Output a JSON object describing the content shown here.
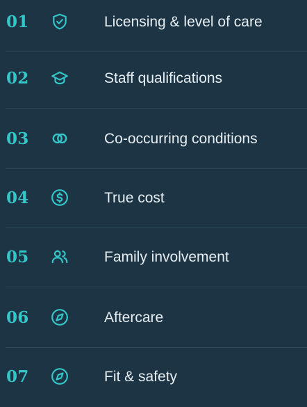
{
  "colors": {
    "background": "#1d3445",
    "accent": "#34c7c9",
    "text": "#e6eef2",
    "divider": "#2d4a5d"
  },
  "items": [
    {
      "number": "01",
      "icon": "shield-check-icon",
      "label": "Licensing & level of care"
    },
    {
      "number": "02",
      "icon": "graduation-cap-icon",
      "label": "Staff qualifications"
    },
    {
      "number": "03",
      "icon": "overlapping-circles-icon",
      "label": "Co-occurring conditions"
    },
    {
      "number": "04",
      "icon": "dollar-circle-icon",
      "label": "True cost"
    },
    {
      "number": "05",
      "icon": "users-icon",
      "label": "Family involvement"
    },
    {
      "number": "06",
      "icon": "compass-icon",
      "label": "Aftercare"
    },
    {
      "number": "07",
      "icon": "compass-icon",
      "label": "Fit & safety"
    }
  ]
}
